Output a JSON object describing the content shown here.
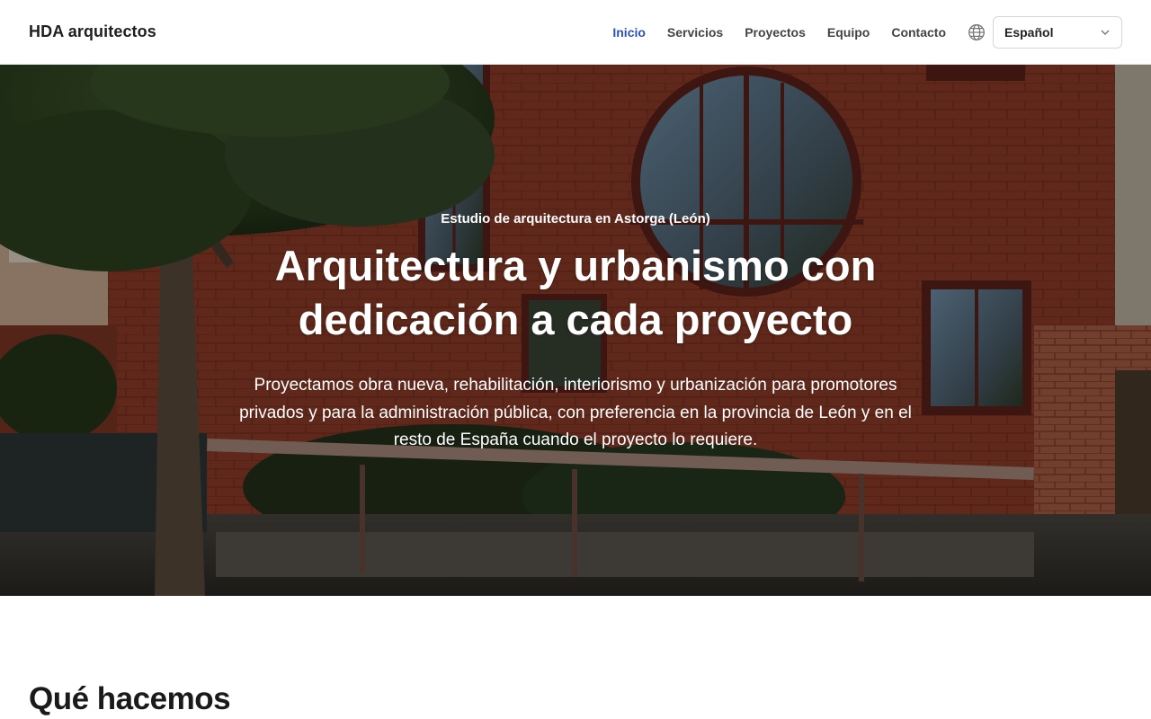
{
  "brand": {
    "name": "HDA arquitectos"
  },
  "nav": {
    "items": [
      {
        "label": "Inicio",
        "active": true
      },
      {
        "label": "Servicios",
        "active": false
      },
      {
        "label": "Proyectos",
        "active": false
      },
      {
        "label": "Equipo",
        "active": false
      },
      {
        "label": "Contacto",
        "active": false
      }
    ],
    "language_icon": "globe-icon",
    "language_selected": "Español"
  },
  "hero": {
    "eyebrow": "Estudio de arquitectura en Astorga (León)",
    "title": "Arquitectura y urbanismo con dedicación a cada proyecto",
    "description": "Proyectamos obra nueva, rehabilitación, interiorismo y urbanización para promotores privados y para la administración pública, con preferencia en la provincia de León y en el resto de España cuando el proyecto lo requiere."
  },
  "section": {
    "title": "Qué hacemos"
  },
  "colors": {
    "accent": "#2a52be",
    "brick": "#8a3a26",
    "text": "#1f1f1f"
  }
}
